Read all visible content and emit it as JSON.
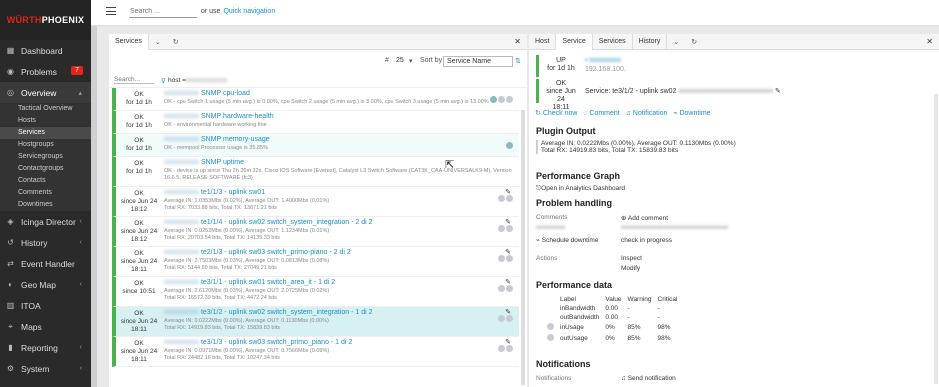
{
  "brand": {
    "logo_text_red": "WÜRTH",
    "logo_text_white": "PHOENIX"
  },
  "sidebar": {
    "items": [
      {
        "label": "Dashboard",
        "icon": "dashboard-icon"
      },
      {
        "label": "Problems",
        "icon": "problems-icon",
        "badge": "7"
      },
      {
        "label": "Overview",
        "icon": "overview-icon"
      },
      {
        "label": "Icinga Director",
        "icon": "director-icon"
      },
      {
        "label": "History",
        "icon": "history-icon"
      },
      {
        "label": "Event Handler",
        "icon": "event-handler-icon"
      },
      {
        "label": "Geo Map",
        "icon": "geo-map-icon"
      },
      {
        "label": "ITOA",
        "icon": "itoa-icon"
      },
      {
        "label": "Maps",
        "icon": "maps-icon"
      },
      {
        "label": "Reporting",
        "icon": "reporting-icon"
      },
      {
        "label": "System",
        "icon": "system-icon"
      }
    ],
    "overview_sub": [
      "Tactical Overview",
      "Hosts",
      "Services",
      "Hostgroups",
      "Servicegroups",
      "Contactgroups",
      "Contacts",
      "Comments",
      "Downtimes"
    ]
  },
  "topbar": {
    "search_placeholder": "Search ...",
    "or_use": "or use",
    "quick_nav": "Quick navigation"
  },
  "left": {
    "tab": "Services",
    "limit": "25",
    "sort_by_label": "Sort by",
    "sort_value": "Service Name",
    "search_placeholder": "Search...",
    "filter": "host =",
    "rows": [
      {
        "state": "OK",
        "since": "for 1d 1h",
        "name": "SNMP cpu-load",
        "desc": "OK - cpu Switch 1 usage (5 min avg.) is 0.00%, cpu Switch 2 usage (5 min avg.) is 3.00%, cpu Switch 3 usage (5 min avg.) is 13.00%"
      },
      {
        "state": "OK",
        "since": "for 1d 1h",
        "name": "SNMP hardware-health",
        "desc": "OK - environmental hardware working fine"
      },
      {
        "state": "OK",
        "since": "for 1d 1h",
        "name": "SNMP memory-usage",
        "desc": "OK - mempool Processor usage is 35.85%"
      },
      {
        "state": "OK",
        "since": "for 1d 1h",
        "name": "SNMP uptime",
        "desc": "OK - device is up since Thu 2h 26m 32s, Cisco IOS Software [Everest], Catalyst L3 Switch Software (CAT3K_CAA-UNIVERSALK9-M), Version",
        "desc2": "16.6.5, RELEASE SOFTWARE (fc3)"
      },
      {
        "state": "OK",
        "since": "since Jun 24",
        "time": "18:12",
        "name": "te1/1/3 - uplink sw01",
        "desc": "Average IN: 1.0353Mbs (0.02%), Average OUT: 1.4000Mbs (0.01%)",
        "desc2": "Total RX: 7033.88 bits, Total TX: 13871.21 bits"
      },
      {
        "state": "OK",
        "since": "since Jun 24",
        "time": "18:12",
        "name": "te1/1/4 - uplink sw02 switch_system_integration - 2 di 2",
        "desc": "Average IN: 0.0252Mbs (0.00%), Average OUT: 1.1234Mbs (0.01%)",
        "desc2": "Total RX: 20703.54 bits, Total TX: 14135.33 bits"
      },
      {
        "state": "OK",
        "since": "since Jun 24",
        "time": "18:11",
        "name": "te2/1/3 - uplink sw03 switch_primo-piano - 2 di 2",
        "desc": "Average IN: 2.7503Mbs (0.03%), Average OUT: 0.0813Mbs (0.08%)",
        "desc2": "Total RX: 5144.69 bits, Total TX: 27049.21 bits"
      },
      {
        "state": "OK",
        "since": "since 10:51",
        "name": "te3/1/1 - uplink sw01 switch_area_it - 1 di 2",
        "desc": "Average IN: 2.6120Mbs (0.03%), Average OUT: 2.0725Mbs (0.02%)",
        "desc2": "Total RX: 16572.39 bits, Total TX: 4472.24 bits"
      },
      {
        "state": "OK",
        "since": "since Jun 24",
        "time": "18:11",
        "name": "te3/1/2 - uplink sw02 switch_system_integration - 1 di 2",
        "desc": "Average IN: 0.0222Mbs (0.00%), Average OUT: 0.1130Mbs (0.00%)",
        "desc2": "Total RX: 14919.83 bits, Total TX: 15839.83 bits",
        "selected": true
      },
      {
        "state": "OK",
        "since": "since Jun 24",
        "time": "18:11",
        "name": "te3/1/3 - uplink sw03 switch_primo_piano - 1 di 2",
        "desc": "Average IN: 0.0971Mbs (0.00%), Average OUT: 0.7566Mbs (0.09%)",
        "desc2": "Total RX: 24482.16 bits, Total TX: 10247.34 bits"
      }
    ]
  },
  "right": {
    "tabs": [
      "Host",
      "Service",
      "Services",
      "History"
    ],
    "host_state": "UP",
    "host_since": "for 1d 1h",
    "host_ip": "192.168.100.",
    "svc_state": "OK",
    "svc_since": "since Jun 24",
    "svc_time": "18:11",
    "svc_name": "Service: te3/1/2 - uplink sw02",
    "actions": [
      "Check now",
      "Comment",
      "Notification",
      "Downtime"
    ],
    "plugin_output_title": "Plugin Output",
    "plugin_output_1": "Average IN: 0.0222Mbs (0.00%), Average OUT: 0.1130Mbs (0.00%)",
    "plugin_output_2": "Total RX: 14919.83 bits, Total TX: 15839.83 bits",
    "perf_graph_title": "Performance Graph",
    "perf_graph_link": "Open in Analytics Dashboard",
    "problem_title": "Problem handling",
    "comments_label": "Comments",
    "add_comment": "Add comment",
    "schedule_downtime": "Schedule downtime",
    "check_progress": "check in progress",
    "actions_label": "Actions",
    "inspect": "Inspect",
    "modify": "Modify",
    "perf_data_title": "Performance data",
    "perf_headers": [
      "Label",
      "Value",
      "Warning",
      "Critical"
    ],
    "perf_rows": [
      {
        "label": "inBandwidth",
        "value": "0.00",
        "warn": "-",
        "crit": "-"
      },
      {
        "label": "outBandwidth",
        "value": "0.00",
        "warn": "-",
        "crit": "-"
      },
      {
        "label": "inUsage",
        "value": "0%",
        "warn": "85%",
        "crit": "98%"
      },
      {
        "label": "outUsage",
        "value": "0%",
        "warn": "85%",
        "crit": "98%"
      }
    ],
    "notif_title": "Notifications",
    "notif_label": "Notifications",
    "send_notif": "Send notification"
  }
}
